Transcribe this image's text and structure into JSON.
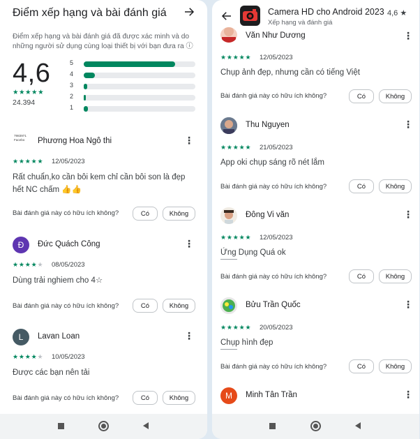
{
  "left": {
    "header": {
      "title": "Điểm xếp hạng và bài đánh giá",
      "arrow_icon": "arrow-right-icon"
    },
    "description": "Điểm xếp hạng và bài đánh giá đã được xác minh và do những người sử dụng cùng loại thiết bị với bạn đưa ra ⓘ",
    "summary": {
      "rating": "4,6",
      "stars": "★★★★★",
      "count": "24.394",
      "distribution": [
        {
          "label": "5",
          "fraction": 0.82
        },
        {
          "label": "4",
          "fraction": 0.1
        },
        {
          "label": "3",
          "fraction": 0.03
        },
        {
          "label": "2",
          "fraction": 0.02
        },
        {
          "label": "1",
          "fraction": 0.04
        }
      ]
    },
    "reviews": [
      {
        "avatar_text": "7983971\nFacebo",
        "name": "Phương Hoa Ngô thi",
        "stars_on": "★★★★★",
        "stars_off": "",
        "date": "12/05/2023",
        "text": "Rất chuẩn,ko cần bôi kem chỉ cần bôi son là đẹp hết NC chấm 👍👍",
        "helpful_q": "Bài đánh giá này có hữu ích không?",
        "yes": "Có",
        "no": "Không"
      },
      {
        "avatar_text": "Đ",
        "avatar_color": "#5e35b1",
        "name": "Đức Quách Công",
        "stars_on": "★★★★",
        "stars_off": "★",
        "date": "08/05/2023",
        "text": "Dùng trải nghiem cho 4☆",
        "helpful_q": "Bài đánh giá này có hữu ích không?",
        "yes": "Có",
        "no": "Không"
      },
      {
        "avatar_text": "L",
        "avatar_color": "#455a64",
        "name": "Lavan Loan",
        "stars_on": "★★★★",
        "stars_off": "★",
        "date": "10/05/2023",
        "text": "Được các bạn nên tải",
        "helpful_q": "Bài đánh giá này có hữu ích không?",
        "yes": "Có",
        "no": "Không"
      }
    ]
  },
  "right": {
    "header": {
      "back_icon": "arrow-left-icon",
      "app_icon": "camera-app-icon",
      "title": "Camera HD cho Android 2023",
      "rating": "4,6 ★",
      "subtitle": "Xếp hạng và đánh giá"
    },
    "reviews": [
      {
        "name": "Văn Như Dương",
        "stars": "★★★★★",
        "date": "12/05/2023",
        "text": "Chụp ảnh đẹp, nhưng cần có tiếng Việt",
        "helpful_q": "Bài đánh giá này có hữu ích không?",
        "yes": "Có",
        "no": "Không"
      },
      {
        "name": "Thu Nguyen",
        "stars": "★★★★★",
        "date": "21/05/2023",
        "text": "App oki chụp sáng rõ nét lắm",
        "helpful_q": "Bài đánh giá này có hữu ích không?",
        "yes": "Có",
        "no": "Không"
      },
      {
        "name": "Đông Vi văn",
        "stars": "★★★★★",
        "date": "12/05/2023",
        "text": "Ứng Dụng Quá ok",
        "helpful_q": "Bài đánh giá này có hữu ích không?",
        "yes": "Có",
        "no": "Không"
      },
      {
        "name": "Bửu Trần Quốc",
        "stars": "★★★★★",
        "date": "20/05/2023",
        "text": "Chụp hình đẹp",
        "helpful_q": "Bài đánh giá này có hữu ích không?",
        "yes": "Có",
        "no": "Không"
      },
      {
        "avatar_text": "M",
        "avatar_color": "#e64a19",
        "name": "Minh Tân Trần"
      }
    ]
  },
  "navbar": {
    "icons": [
      "recent-apps-icon",
      "home-icon",
      "back-icon"
    ]
  }
}
